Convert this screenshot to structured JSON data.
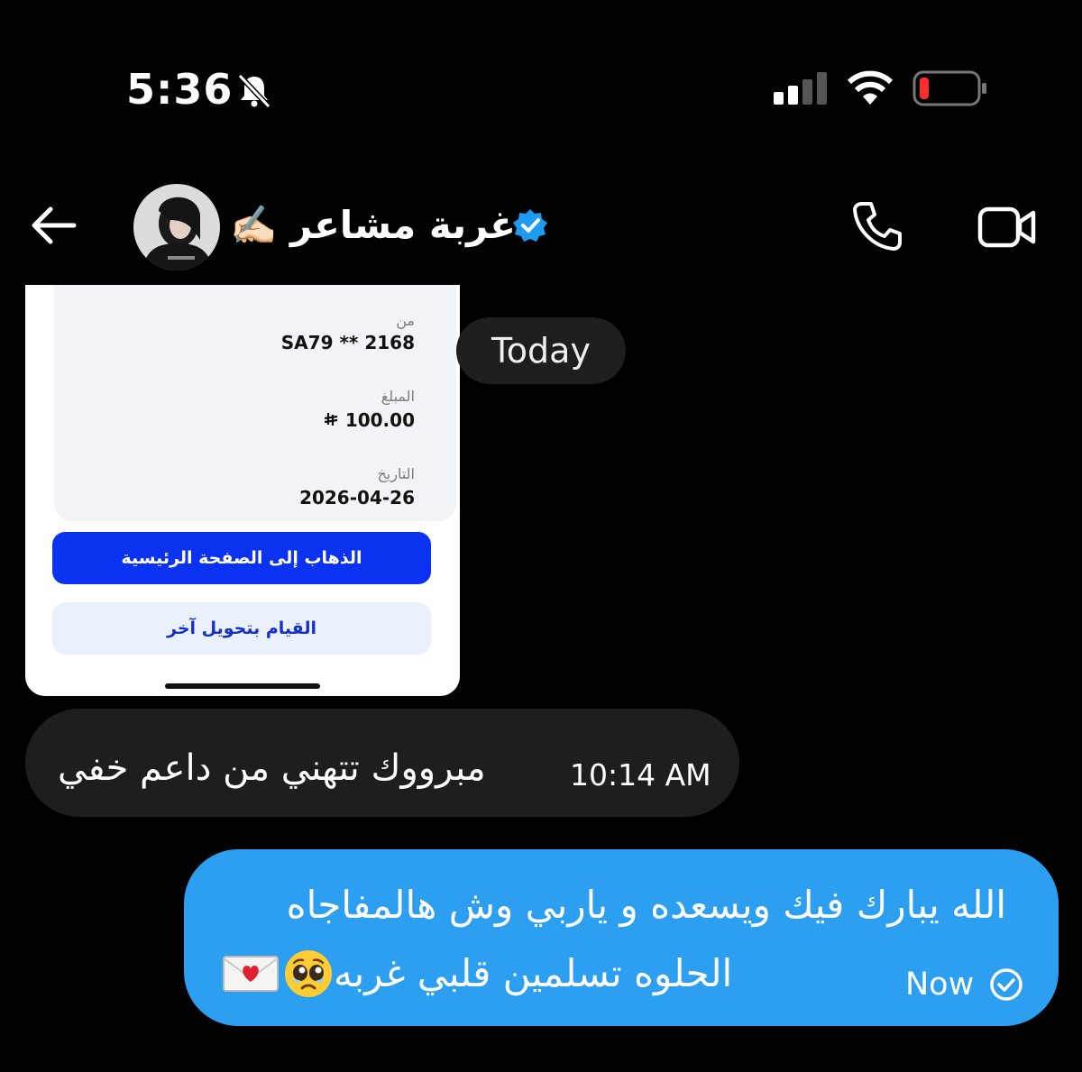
{
  "status_bar": {
    "time": "5:36",
    "icons": [
      "bell-slash-icon",
      "cellular-signal-icon",
      "wifi-icon",
      "battery-low-icon"
    ]
  },
  "header": {
    "contact_name": "غربة مشاعر ✍🏻",
    "verified": true,
    "icons": [
      "back-arrow-icon",
      "phone-icon",
      "video-camera-icon"
    ]
  },
  "transfer_card": {
    "from_label": "من",
    "from_value": "SA79 ** 2168",
    "amount_label": "المبلغ",
    "amount_value": "100.00",
    "currency_symbol": "⃁",
    "date_label": "التاريخ",
    "date_value": "2026-04-26",
    "primary_button": "الذهاب إلى الصفحة الرئيسية",
    "secondary_button": "القيام بتحويل آخر"
  },
  "date_divider": "Today",
  "messages": [
    {
      "direction": "incoming",
      "text": "مبرووك تتهني من داعم خفي",
      "time": "10:14 AM"
    },
    {
      "direction": "outgoing",
      "line1": "الله يبارك فيك ويسعده و ياربي وش هالمفاجاه",
      "line2": "الحلوه تسلمين قلبي غربه",
      "time": "Now",
      "emoji": [
        "pleading-face-emoji",
        "love-letter-emoji"
      ]
    }
  ],
  "colors": {
    "background": "#000000",
    "incoming_bubble": "#1e1e1e",
    "outgoing_bubble": "#2d9ff0",
    "verified_badge": "#1d9bf0",
    "primary_button": "#0b32f0",
    "battery_low": "#ff2d2d"
  }
}
